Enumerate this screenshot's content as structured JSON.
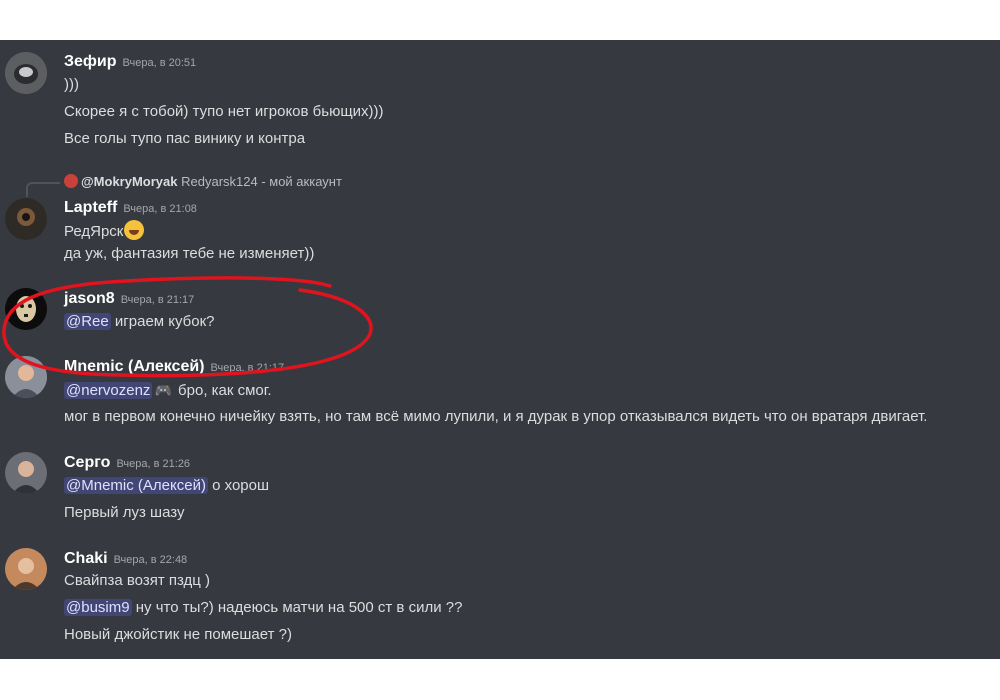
{
  "messages": [
    {
      "author": "Зефир",
      "time": "Вчера, в 20:51",
      "avatar_color": "#6d6f73",
      "lines": [
        "))) ",
        "Скорее я с тобой) тупо нет игроков бьющих)))",
        "Все голы тупо пас винику и контра"
      ]
    },
    {
      "reply": {
        "name": "@MokryMoryak",
        "text": "Redyarsk124 - мой аккаунт"
      },
      "author": "Lapteff",
      "time": "Вчера, в 21:08",
      "avatar_color": "#3a3530",
      "lines": [
        "РедЯрск",
        "да уж, фантазия тебе не изменяет))"
      ]
    },
    {
      "author": "jason8",
      "time": "Вчера, в 21:17",
      "avatar_color": "#111111",
      "mention": "@Ree",
      "text": " играем кубок?"
    },
    {
      "author": "Mnemic (Алексей)",
      "time": "Вчера, в 21:17",
      "avatar_color": "#8a8f99",
      "mention": "@nervozenz",
      "text": " бро, как смог.",
      "line2": "мог в первом конечно ничейку взять,  но там всё мимо лупили, и я дурак в упор отказывался видеть что он вратаря двигает."
    },
    {
      "author": "Серго",
      "time": "Вчера, в 21:26",
      "avatar_color": "#5a5d63",
      "mention": "@Mnemic (Алексей)",
      "text": " о хорош",
      "line2": "Первый луз шазу"
    },
    {
      "author": "Chaki",
      "time": "Вчера, в 22:48",
      "avatar_color": "#b07a55",
      "line1": "Свайпза возят пздц )",
      "mention": "@busim9",
      "text": " ну что ты?) надеюсь матчи на 500 ст в сили ??",
      "line3": "Новый джойстик не помешает ?)"
    }
  ],
  "colors": {
    "background": "#36393f",
    "mention_bg": "#414675",
    "annotation": "#e0141e"
  }
}
